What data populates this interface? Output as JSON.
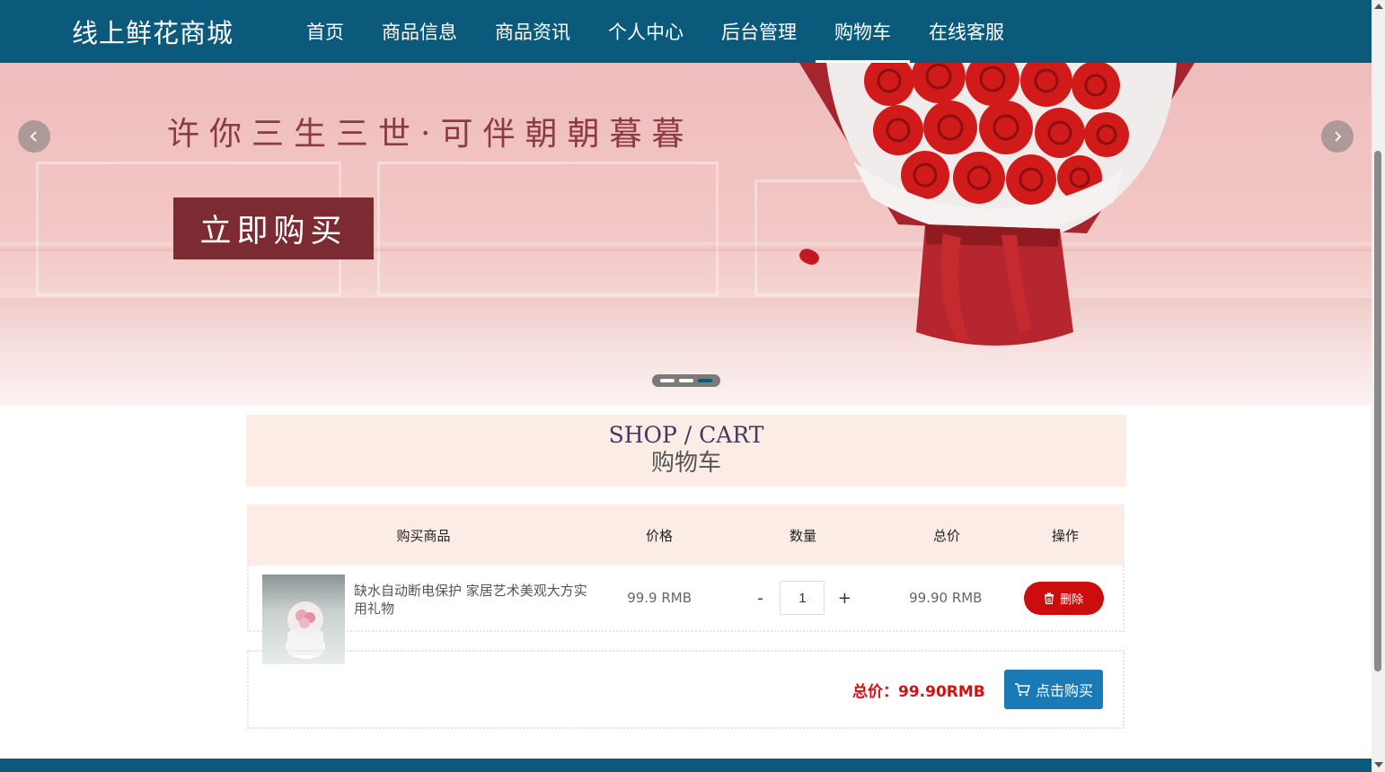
{
  "header": {
    "brand": "线上鲜花商城",
    "nav": [
      {
        "label": "首页"
      },
      {
        "label": "商品信息"
      },
      {
        "label": "商品资讯"
      },
      {
        "label": "个人中心"
      },
      {
        "label": "后台管理"
      },
      {
        "label": "购物车",
        "active": true
      },
      {
        "label": "在线客服"
      }
    ]
  },
  "banner": {
    "slogan": "许你三生三世·可伴朝朝暮暮",
    "button_label": "立即购买",
    "prev_icon": "chevron-left-icon",
    "next_icon": "chevron-right-icon",
    "slide_count": 3,
    "active_slide": 3
  },
  "cart": {
    "title_en": "SHOP / CART",
    "title_cn": "购物车",
    "columns": [
      "购买商品",
      "价格",
      "数量",
      "总价",
      "操作"
    ],
    "items": [
      {
        "name": "缺水自动断电保护 家居艺术美观大方实用礼物",
        "price": "99.9 RMB",
        "quantity": "1",
        "minus": "-",
        "plus": "+",
        "subtotal": "99.90 RMB",
        "delete_label": "删除",
        "delete_icon": "trash-icon"
      }
    ],
    "total_label": "总价：99.90RMB",
    "checkout_label": "点击购买",
    "checkout_icon": "cart-icon"
  },
  "colors": {
    "header_bg": "#0b5a7c",
    "accent_red": "#cc0d0d",
    "checkout_blue": "#1a7ab5",
    "light_peach": "#fbede6"
  }
}
